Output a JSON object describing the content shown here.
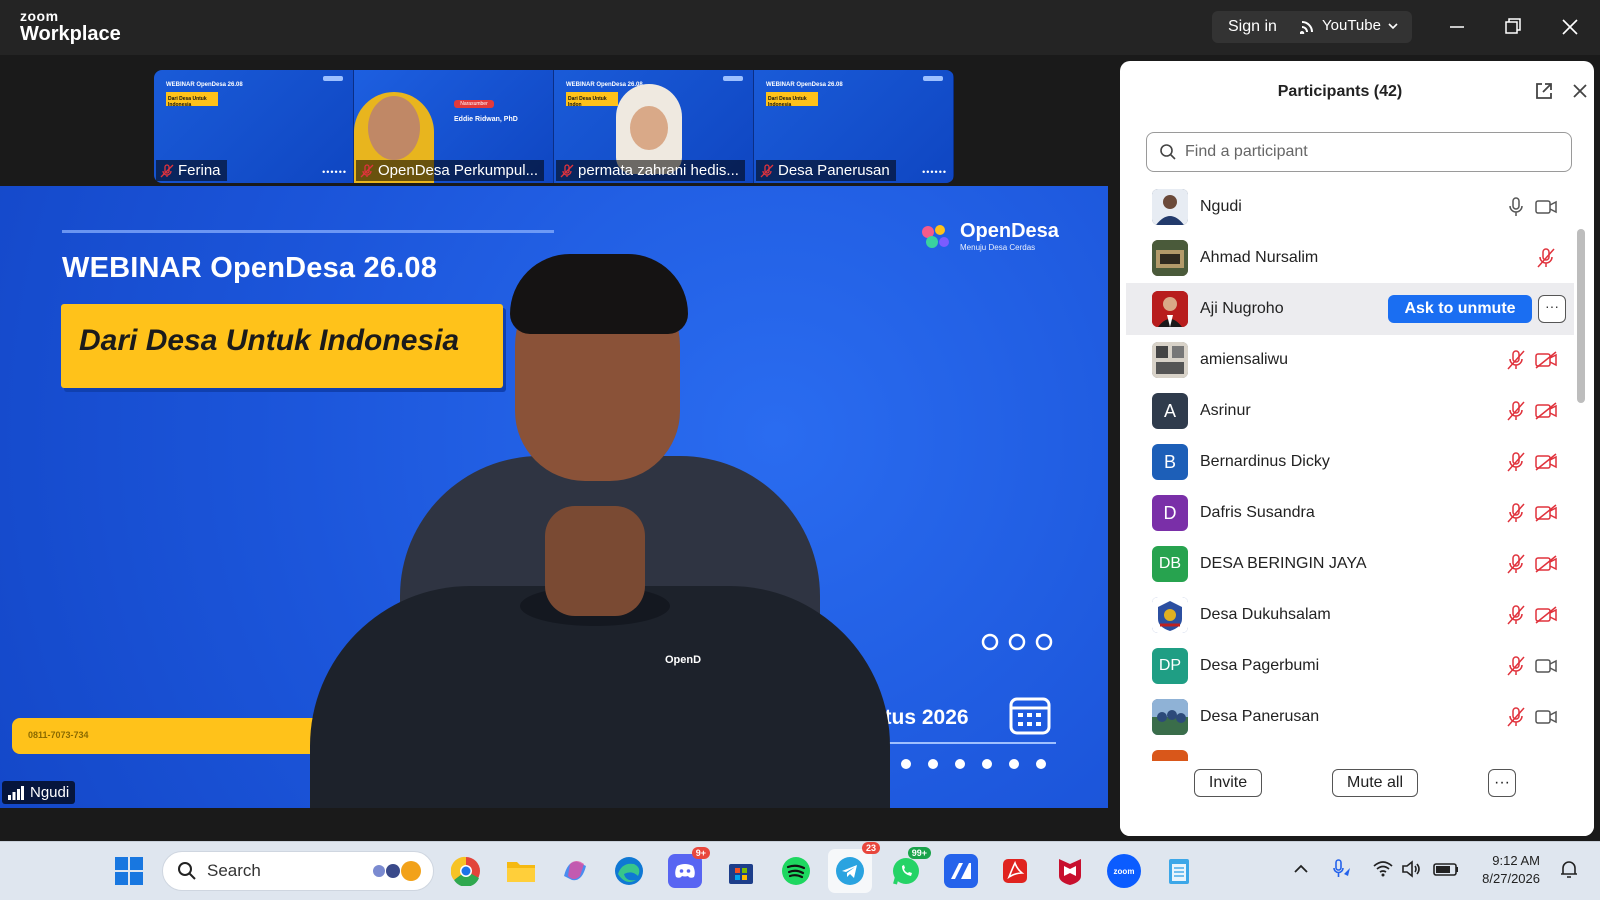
{
  "titlebar": {
    "logo_top": "zoom",
    "logo_bottom": "Workplace",
    "sign_in": "Sign in",
    "stream_label": "YouTube"
  },
  "thumbnails": [
    {
      "name": "Ferina",
      "slide_title": "WEBINAR OpenDesa 26.08",
      "slide_sub": "Dari Desa Untuk Indonesia"
    },
    {
      "name": "OpenDesa Perkumpul...",
      "slide_title": "Narasumber",
      "slide_sub": "Eddie Ridwan, PhD"
    },
    {
      "name": "permata zahrani hedis...",
      "slide_title": "WEBINAR OpenDesa 26.08",
      "slide_sub": "Dari Desa Untuk Indon"
    },
    {
      "name": "Desa Panerusan",
      "slide_title": "WEBINAR OpenDesa 26.08",
      "slide_sub": "Dari Desa Untuk Indonesia"
    }
  ],
  "stage": {
    "slide_title": "WEBINAR OpenDesa 26.08",
    "slide_banner": "Dari Desa Untuk Indonesia",
    "brand": "OpenDesa",
    "brand_sub": "Menuju Desa Cerdas",
    "contact": "0811-7073-734",
    "date_text": "ustus 2026",
    "speaker": "Ngudi",
    "shirt_logo": "OpenD"
  },
  "participants": {
    "title": "Participants (42)",
    "search_placeholder": "Find a participant",
    "ask_unmute": "Ask to unmute",
    "more": "···",
    "list": [
      {
        "name": "Ngudi",
        "avatar": "photo",
        "color": "#3b4a6b",
        "mic": "on",
        "cam": "on"
      },
      {
        "name": "Ahmad Nursalim",
        "avatar": "photo",
        "color": "#6b5a3a",
        "mic": "muted",
        "cam": "none"
      },
      {
        "name": "Aji Nugroho",
        "avatar": "photo",
        "color": "#a01a1a",
        "mic": "none",
        "cam": "none"
      },
      {
        "name": "amiensaliwu",
        "avatar": "photo",
        "color": "#6a6a6a",
        "mic": "muted",
        "cam": "off"
      },
      {
        "name": "Asrinur",
        "avatar": "A",
        "color": "#2f3b4c",
        "mic": "muted",
        "cam": "off"
      },
      {
        "name": "Bernardinus Dicky",
        "avatar": "B",
        "color": "#1d5fb8",
        "mic": "muted",
        "cam": "off"
      },
      {
        "name": "Dafris Susandra",
        "avatar": "D",
        "color": "#7a2fa8",
        "mic": "muted",
        "cam": "off"
      },
      {
        "name": "DESA BERINGIN JAYA",
        "avatar": "DB",
        "color": "#27a34f",
        "mic": "muted",
        "cam": "off"
      },
      {
        "name": "Desa Dukuhsalam",
        "avatar": "photo",
        "color": "#2c4fa0",
        "mic": "muted",
        "cam": "off"
      },
      {
        "name": "Desa Pagerbumi",
        "avatar": "DP",
        "color": "#1f9e84",
        "mic": "muted",
        "cam": "on"
      },
      {
        "name": "Desa Panerusan",
        "avatar": "photo",
        "color": "#3a5d8f",
        "mic": "muted",
        "cam": "on"
      }
    ],
    "invite": "Invite",
    "mute_all": "Mute all"
  },
  "taskbar": {
    "search": "Search",
    "discord_badge": "9+",
    "telegram_badge": "23",
    "whatsapp_badge": "99+",
    "zoom_label": "zoom",
    "time": "9:12 AM",
    "date": "8/27/2026"
  },
  "colors": {
    "accent": "#1a6ef2",
    "muted_red": "#e0323c",
    "slide_blue": "#1e5be3",
    "slide_yellow": "#ffc21a"
  }
}
